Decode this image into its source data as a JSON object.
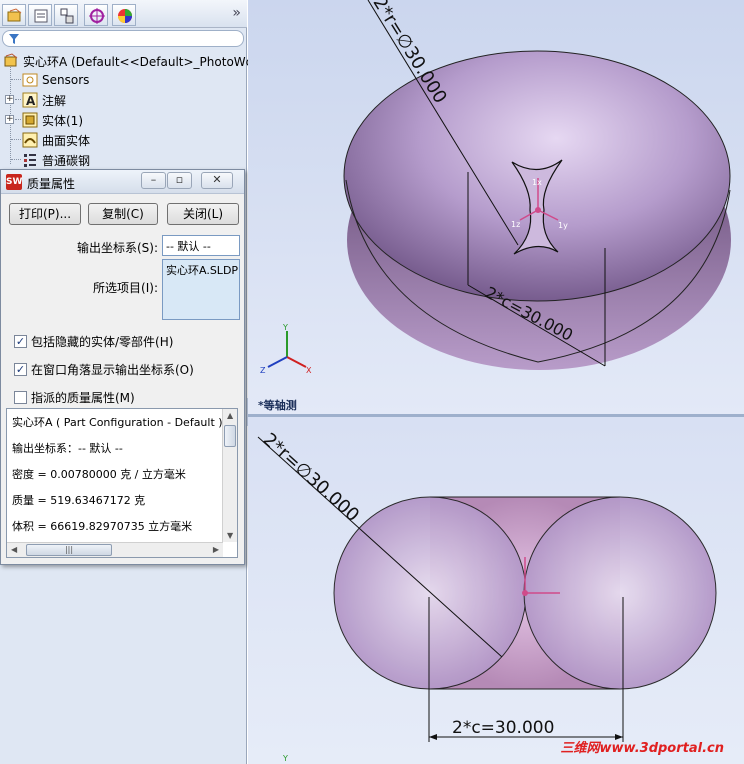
{
  "feature_manager": {
    "tabs": [
      "featuremanager-tab",
      "propertymanager-tab",
      "configurationmanager-tab",
      "dimxpert-tab",
      "display-manager-tab"
    ],
    "more": "»",
    "tree": {
      "root_label": "实心环A  (Default<<Default>_PhotoWc",
      "items": [
        {
          "label": "Sensors",
          "icon": "sensors-icon"
        },
        {
          "label": "注解",
          "icon": "annotations-icon"
        },
        {
          "label": "实体(1)",
          "icon": "solid-bodies-icon"
        },
        {
          "label": "曲面实体",
          "icon": "surface-bodies-icon"
        },
        {
          "label": "普通碳钢",
          "icon": "material-icon"
        }
      ]
    }
  },
  "dialog": {
    "title": "质量属性",
    "buttons": {
      "print": "打印(P)...",
      "copy": "复制(C)",
      "close": "关闭(L)"
    },
    "output_coord_label": "输出坐标系(S):",
    "output_coord_value": "-- 默认 --",
    "selected_items_label": "所选项目(I):",
    "selected_items_value": "实心环A.SLDPRT",
    "checkboxes": [
      {
        "label": "包括隐藏的实体/零部件(H)",
        "checked": true
      },
      {
        "label": "在窗口角落显示输出坐标系(O)",
        "checked": true
      },
      {
        "label": "指派的质量属性(M)",
        "checked": false
      }
    ],
    "results": {
      "line1": "实心环A ( Part Configuration - Default ) 的",
      "line2": "输出坐标系：-- 默认 --",
      "line3": "密度 = 0.00780000 克 /  立方毫米",
      "line4": "质量 = 519.63467172 克",
      "line5": "体积 = 66619.82970735  立方毫米"
    }
  },
  "viewport_top": {
    "view_label": "*等轴测",
    "dim_diameter": "2*r=∅30.000",
    "dim_c": "2*c=30.000",
    "triad_labels": {
      "x": "X",
      "y": "Y",
      "z": "Z"
    },
    "center_triad_labels": {
      "y": "1y",
      "z": "1z",
      "x": "1x"
    },
    "body_color": "#a98fc4"
  },
  "viewport_bottom": {
    "dim_diameter": "2*r=∅30.000",
    "dim_c": "2*c=30.000",
    "triad_label_y": "Y",
    "watermark": "三维网www.3dportal.cn",
    "body_color": "#b79bd0"
  }
}
